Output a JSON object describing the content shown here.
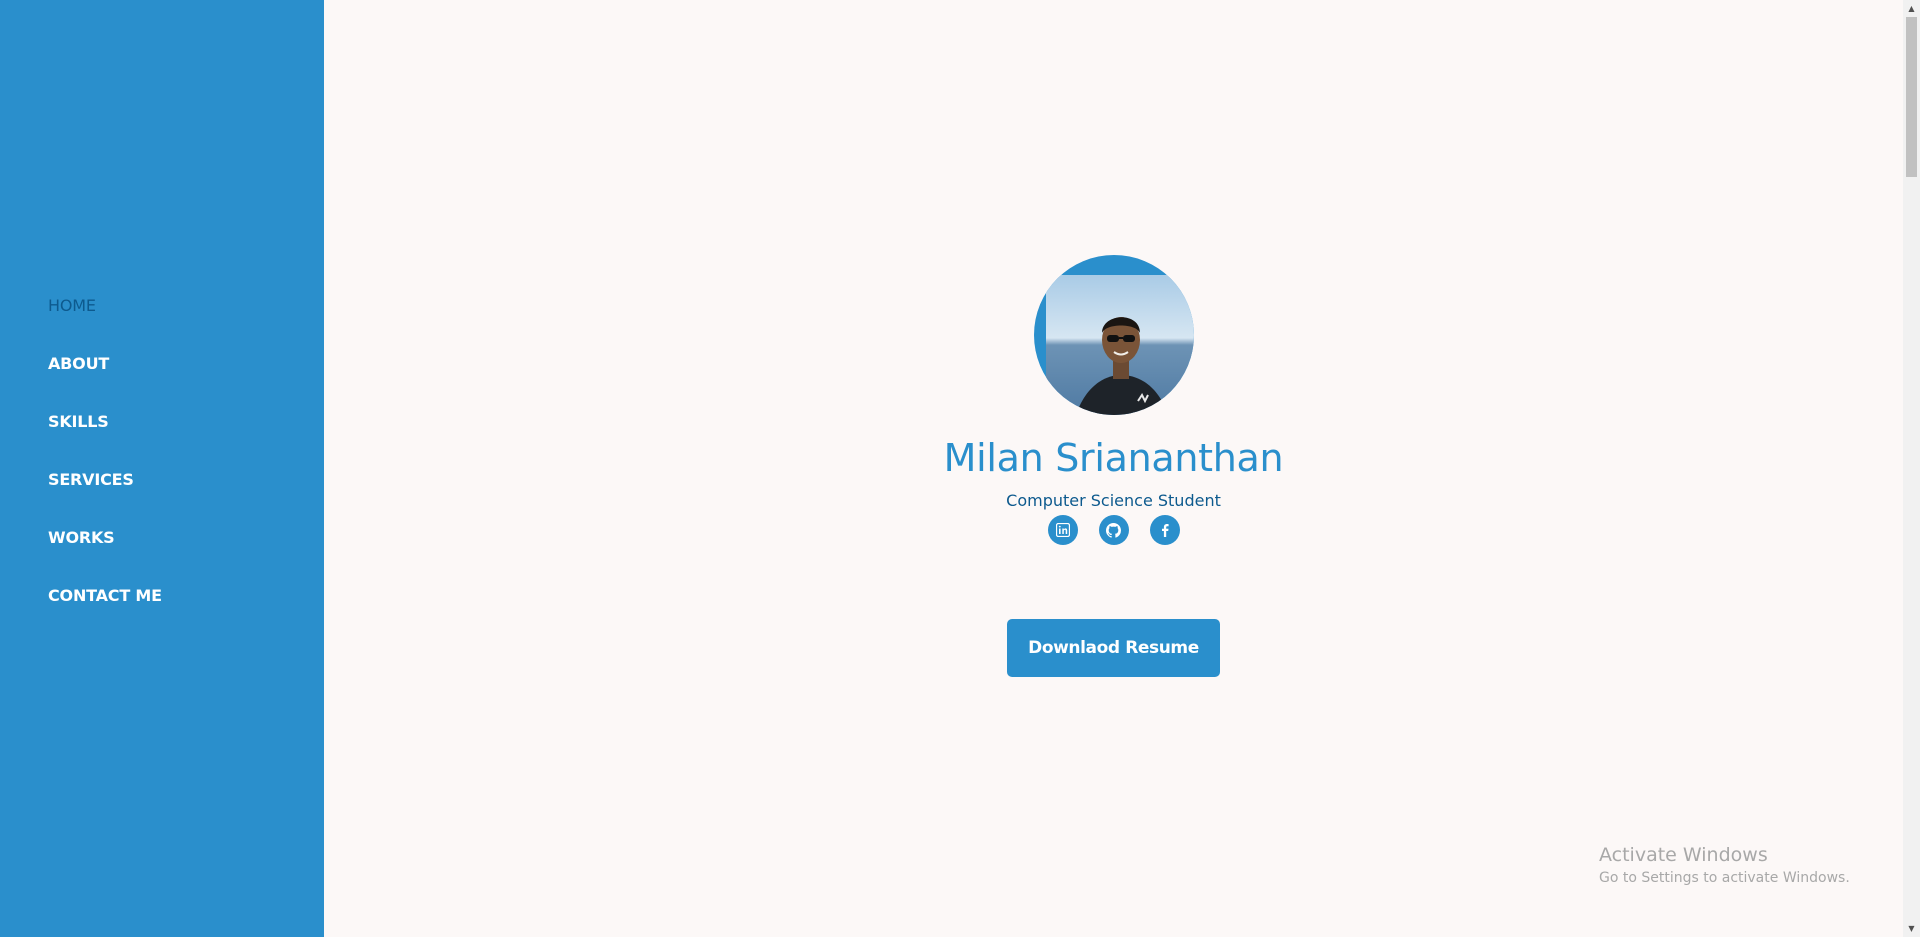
{
  "sidebar": {
    "nav": [
      {
        "label": "HOME",
        "active": true
      },
      {
        "label": "ABOUT"
      },
      {
        "label": "SKILLS"
      },
      {
        "label": "SERVICES"
      },
      {
        "label": "WORKS"
      },
      {
        "label": "CONTACT ME"
      }
    ]
  },
  "hero": {
    "name": "Milan Sriananthan",
    "role": "Computer Science Student",
    "social": [
      {
        "icon": "linkedin-icon"
      },
      {
        "icon": "github-icon"
      },
      {
        "icon": "facebook-icon"
      }
    ],
    "resume_button": "Downlaod Resume"
  },
  "watermark": {
    "title": "Activate Windows",
    "subtitle": "Go to Settings to activate Windows."
  },
  "colors": {
    "accent": "#2a8fcc",
    "dark_accent": "#0d5a8e",
    "background": "#fcf8f7"
  }
}
